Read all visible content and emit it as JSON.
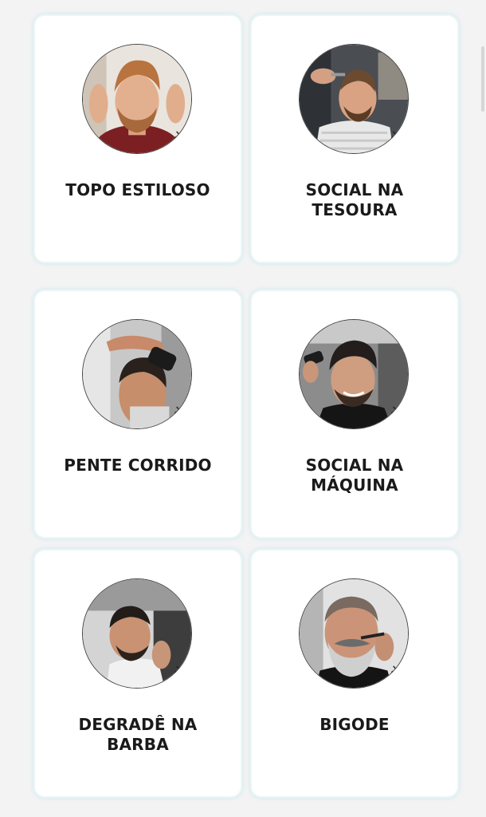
{
  "services": [
    {
      "label": "TOPO ESTILOSO",
      "icon": "haircut-photo-icon"
    },
    {
      "label": "SOCIAL NA\nTESOURA",
      "icon": "haircut-photo-icon"
    },
    {
      "label": "PENTE CORRIDO",
      "icon": "haircut-photo-icon"
    },
    {
      "label": "SOCIAL NA\nMÁQUINA",
      "icon": "haircut-photo-icon"
    },
    {
      "label": "DEGRADÊ NA\nBARBA",
      "icon": "beard-photo-icon"
    },
    {
      "label": "BIGODE",
      "icon": "mustache-photo-icon"
    }
  ],
  "colors": {
    "card_background": "#ffffff",
    "page_background": "#f3f3f4",
    "card_glow": "#a0d7e1",
    "text": "#1a1a1a"
  }
}
